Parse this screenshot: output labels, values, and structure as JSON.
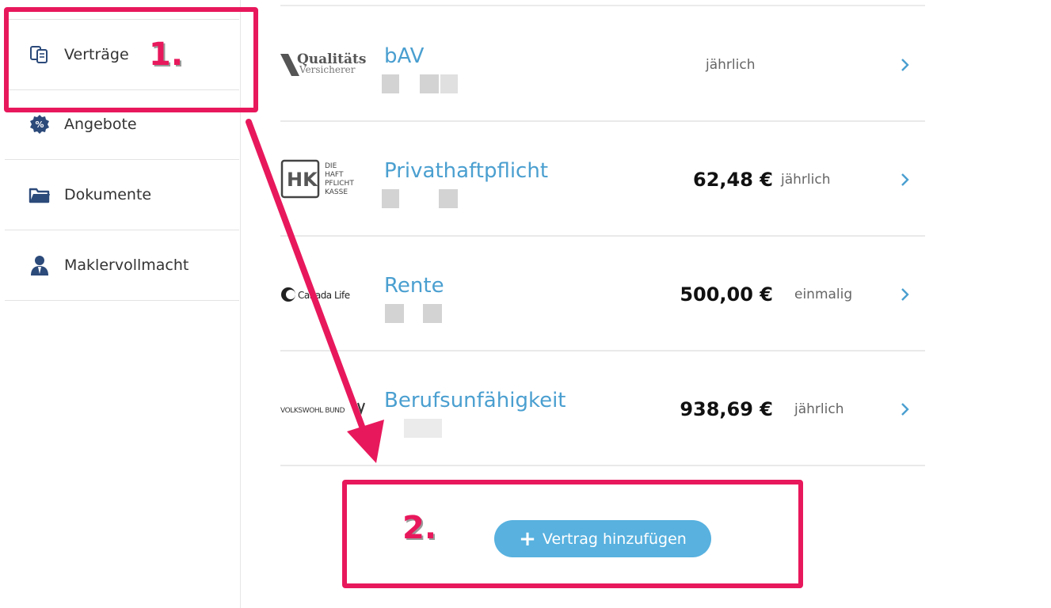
{
  "sidebar": {
    "items": [
      {
        "label": "Verträge",
        "icon": "contracts-icon"
      },
      {
        "label": "Angebote",
        "icon": "offers-icon"
      },
      {
        "label": "Dokumente",
        "icon": "folder-icon"
      },
      {
        "label": "Maklervollmacht",
        "icon": "person-icon"
      }
    ]
  },
  "contracts": [
    {
      "insurer_logo": "Qualitäts Versicherer",
      "logo_line1": "Qualitäts",
      "logo_line2": "Versicherer",
      "title": "bAV",
      "amount": "",
      "period": "jährlich"
    },
    {
      "insurer_logo": "Die Haftpflichtkasse",
      "logo_mark": "HK",
      "logo_words": "DIE HAFT PFLICHT KASSE",
      "title": "Privathaftpflicht",
      "amount": "62,48 €",
      "period": "jährlich"
    },
    {
      "insurer_logo": "Canada Life",
      "logo_text": "Canada Life",
      "title": "Rente",
      "amount": "500,00 €",
      "period": "einmalig"
    },
    {
      "insurer_logo": "Volkswohl Bund",
      "logo_text": "VOLKSWOHL BUND",
      "title": "Berufsunfähigkeit",
      "amount": "938,69 €",
      "period": "jährlich"
    }
  ],
  "add_button": {
    "label": "Vertrag hinzufügen",
    "icon": "plus-icon"
  },
  "annotations": {
    "step1": "1.",
    "step2": "2."
  },
  "colors": {
    "accent": "#4a9fd0",
    "button": "#58b1df",
    "annotation": "#e8185c"
  }
}
